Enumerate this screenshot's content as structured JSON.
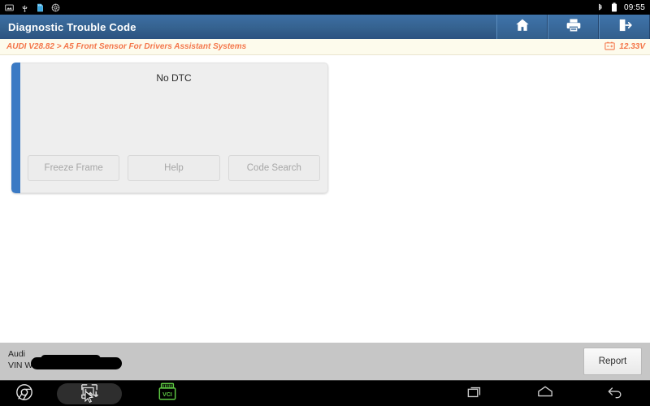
{
  "statusbar": {
    "icons_left": [
      "screenshot-icon",
      "usb-icon",
      "sdcard-icon",
      "settings-icon"
    ],
    "icons_right": [
      "bluetooth-icon",
      "battery-icon"
    ],
    "time": "09:55"
  },
  "titlebar": {
    "title": "Diagnostic Trouble Code",
    "actions": [
      {
        "name": "home-button",
        "icon": "home-icon"
      },
      {
        "name": "print-button",
        "icon": "printer-icon"
      },
      {
        "name": "exit-button",
        "icon": "exit-icon"
      }
    ]
  },
  "pathbar": {
    "breadcrumb": "AUDI V28.82 > A5 Front Sensor For Drivers Assistant Systems",
    "voltage": "12.33V",
    "voltage_icon": "car-battery-icon",
    "text_color": "#f4764a",
    "background": "#fdfbec"
  },
  "main": {
    "accent_color": "#3b7ac4",
    "dtc_status": "No DTC",
    "buttons": [
      {
        "label": "Freeze Frame",
        "name": "freeze-frame-button"
      },
      {
        "label": "Help",
        "name": "help-button"
      },
      {
        "label": "Code Search",
        "name": "code-search-button"
      }
    ]
  },
  "footer": {
    "make": "Audi",
    "vin_label": "VIN WA",
    "report_label": "Report"
  },
  "navbar": {
    "left_items": [
      {
        "name": "chrome-button",
        "icon": "chrome-icon"
      },
      {
        "name": "screen-capture-button",
        "icon": "capture-icon"
      },
      {
        "name": "vci-button",
        "icon": "vci-icon",
        "label": "VCI"
      }
    ],
    "right_items": [
      {
        "name": "recents-button",
        "icon": "recents-icon"
      },
      {
        "name": "home-nav-button",
        "icon": "home-outline-icon"
      },
      {
        "name": "back-button",
        "icon": "back-arrow-icon"
      }
    ],
    "vci_color": "#5ec843"
  }
}
